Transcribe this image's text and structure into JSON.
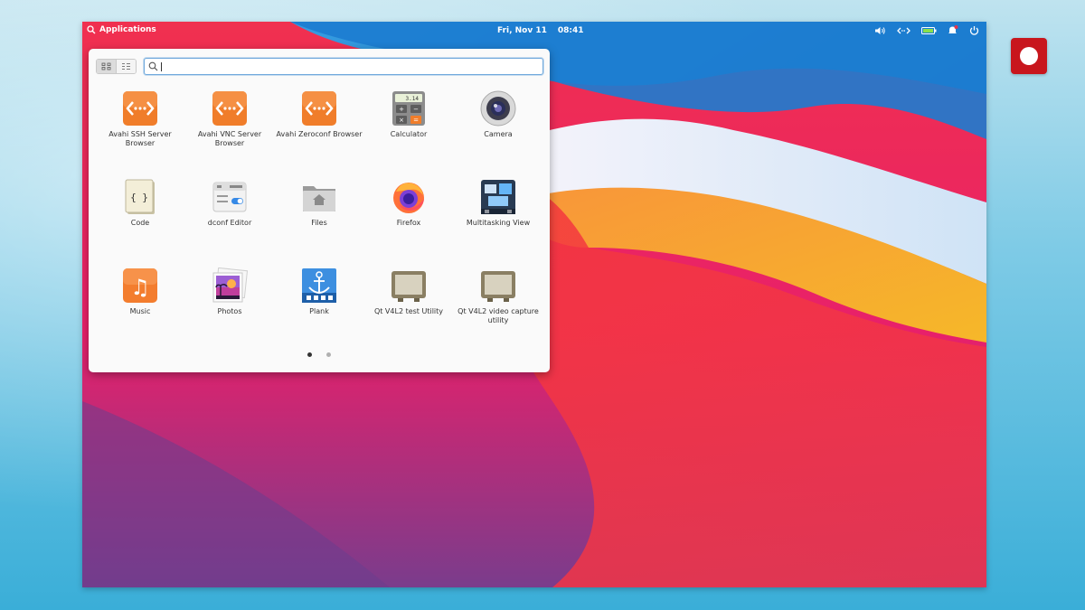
{
  "topbar": {
    "applications_label": "Applications",
    "date": "Fri, Nov 11",
    "time": "08:41"
  },
  "launcher": {
    "search_value": "",
    "current_page": 1,
    "page_count": 2,
    "apps": [
      {
        "name": "Avahi SSH Server Browser",
        "icon": "avahi-icon"
      },
      {
        "name": "Avahi VNC Server Browser",
        "icon": "avahi-icon"
      },
      {
        "name": "Avahi Zeroconf Browser",
        "icon": "avahi-icon"
      },
      {
        "name": "Calculator",
        "icon": "calculator-icon",
        "display": "3.14"
      },
      {
        "name": "Camera",
        "icon": "camera-icon"
      },
      {
        "name": "Code",
        "icon": "code-icon",
        "glyph": "{ }"
      },
      {
        "name": "dconf Editor",
        "icon": "dconf-editor-icon"
      },
      {
        "name": "Files",
        "icon": "files-icon"
      },
      {
        "name": "Firefox",
        "icon": "firefox-icon"
      },
      {
        "name": "Multitasking View",
        "icon": "multitasking-view-icon"
      },
      {
        "name": "Music",
        "icon": "music-icon",
        "glyph": "♫"
      },
      {
        "name": "Photos",
        "icon": "photos-icon"
      },
      {
        "name": "Plank",
        "icon": "plank-icon"
      },
      {
        "name": "Qt V4L2 test Utility",
        "icon": "qt-v4l2-icon"
      },
      {
        "name": "Qt V4L2 video capture utility",
        "icon": "qt-v4l2-icon"
      }
    ]
  },
  "colors": {
    "accent": "#6fa8dc",
    "avahi_orange": "#f07d2a",
    "record_red": "#c8161d"
  }
}
